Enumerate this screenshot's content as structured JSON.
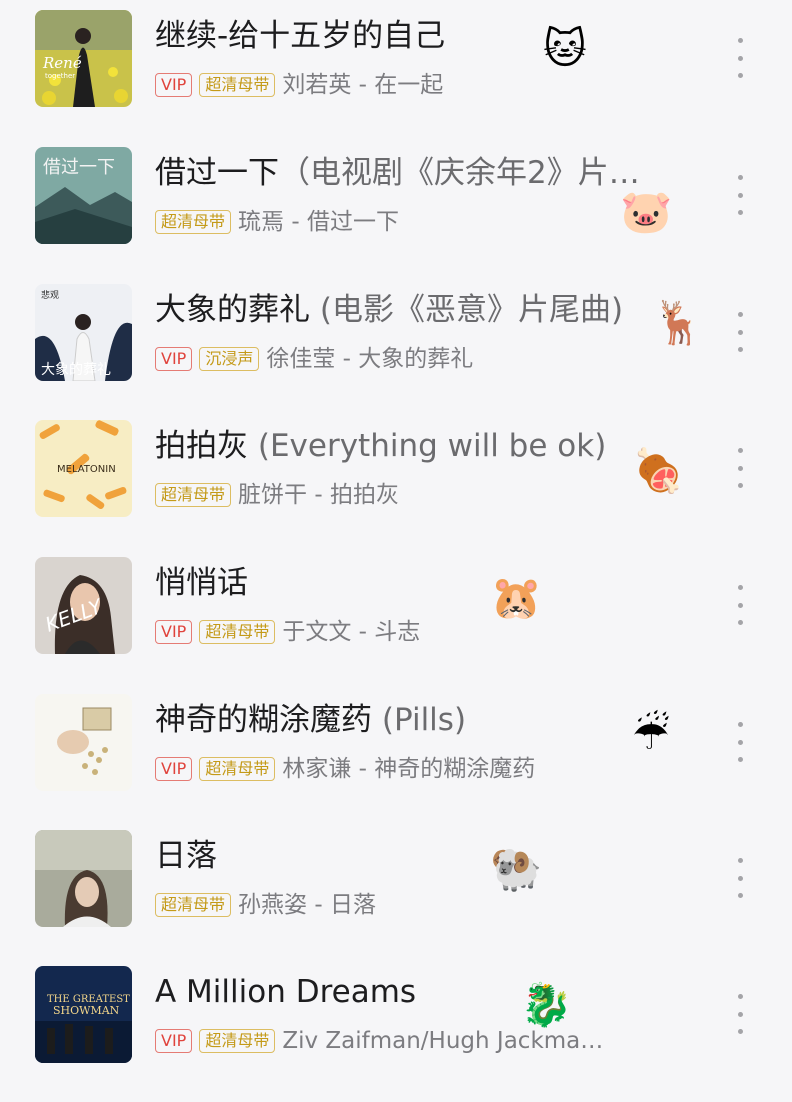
{
  "songs": [
    {
      "title": "继续-给十五岁的自己",
      "subtitle": "",
      "badges": [
        "VIP",
        "超清母带"
      ],
      "artist": "刘若英",
      "album": "在一起",
      "emoji": "🐱"
    },
    {
      "title": "借过一下",
      "subtitle": "（电视剧《庆余年2》片…",
      "badges": [
        "超清母带"
      ],
      "artist": "琉焉",
      "album": "借过一下",
      "emoji": "🐷"
    },
    {
      "title": "大象的葬礼",
      "subtitle": " (电影《恶意》片尾曲)",
      "badges": [
        "VIP",
        "沉浸声"
      ],
      "artist": "徐佳莹",
      "album": "大象的葬礼",
      "emoji": "🦌"
    },
    {
      "title": "拍拍灰",
      "subtitle": " (Everything will be ok)",
      "badges": [
        "超清母带"
      ],
      "artist": "脏饼干",
      "album": "拍拍灰",
      "emoji": "🍖"
    },
    {
      "title": "悄悄话",
      "subtitle": "",
      "badges": [
        "VIP",
        "超清母带"
      ],
      "artist": "于文文",
      "album": "斗志",
      "emoji": "🐹"
    },
    {
      "title": "神奇的糊涂魔药",
      "subtitle": " (Pills)",
      "badges": [
        "VIP",
        "超清母带"
      ],
      "artist": "林家谦",
      "album": "神奇的糊涂魔药",
      "emoji": "☔"
    },
    {
      "title": "日落",
      "subtitle": "",
      "badges": [
        "超清母带"
      ],
      "artist": "孙燕姿",
      "album": "日落",
      "emoji": "🐏"
    },
    {
      "title": "A Million Dreams",
      "subtitle": "",
      "badges": [
        "VIP",
        "超清母带"
      ],
      "artist": "Ziv Zaifman/Hugh Jackma…",
      "album": "",
      "emoji": "🐉"
    }
  ],
  "covers": {
    "c0": {
      "text": "René",
      "text2": "together"
    },
    "c1": {
      "text": "借过一下"
    },
    "c2": {
      "text": "大象的葬礼",
      "text2": "悲观"
    },
    "c3": {
      "text": "MELATONIN"
    },
    "c4": {
      "text": "KELLY"
    },
    "c6": {
      "text": ""
    },
    "c7": {
      "text": "THE GREATEST",
      "text2": "SHOWMAN"
    }
  },
  "colors": {
    "vip": "#e0443d",
    "hq": "#c49a18",
    "title": "#1d1d1f",
    "meta": "#7c7c80"
  }
}
